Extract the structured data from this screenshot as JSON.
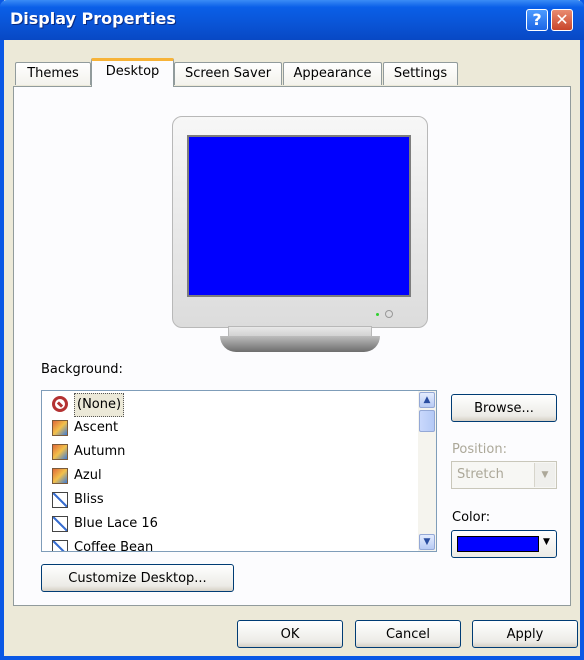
{
  "window": {
    "title": "Display Properties",
    "help_label": "?",
    "close_label": "✕"
  },
  "tabs": [
    {
      "label": "Themes"
    },
    {
      "label": "Desktop"
    },
    {
      "label": "Screen Saver"
    },
    {
      "label": "Appearance"
    },
    {
      "label": "Settings"
    }
  ],
  "active_tab": "Desktop",
  "preview": {
    "screen_color": "#0000ff"
  },
  "background": {
    "label": "Background:",
    "selected": "(None)",
    "items": [
      {
        "label": "(None)",
        "icon": "no-symbol-icon"
      },
      {
        "label": "Ascent",
        "icon": "image-file-icon"
      },
      {
        "label": "Autumn",
        "icon": "image-file-icon"
      },
      {
        "label": "Azul",
        "icon": "image-file-icon"
      },
      {
        "label": "Bliss",
        "icon": "bitmap-file-icon"
      },
      {
        "label": "Blue Lace 16",
        "icon": "bitmap-file-icon"
      },
      {
        "label": "Coffee Bean",
        "icon": "bitmap-file-icon"
      }
    ],
    "scroll_up_icon": "▲",
    "scroll_down_icon": "▼"
  },
  "browse_label": "Browse...",
  "position": {
    "label": "Position:",
    "value": "Stretch",
    "arrow_icon": "▼"
  },
  "color": {
    "label": "Color:",
    "value": "#0000ff",
    "arrow_icon": "▼"
  },
  "customize_label": "Customize Desktop...",
  "buttons": {
    "ok": "OK",
    "cancel": "Cancel",
    "apply": "Apply"
  }
}
